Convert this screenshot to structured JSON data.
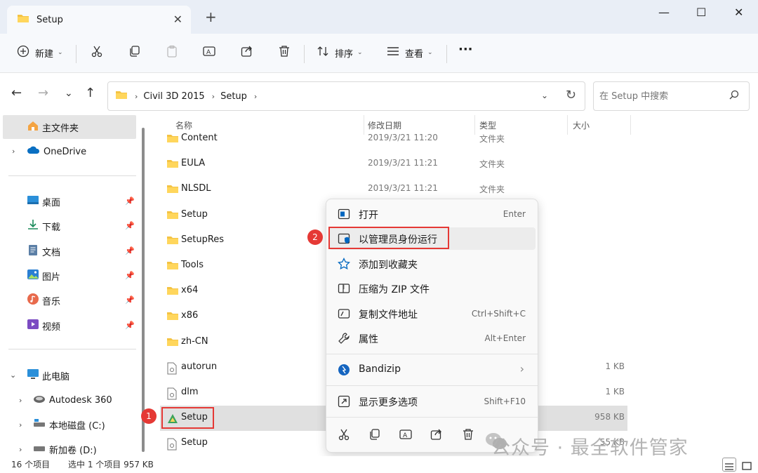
{
  "window": {
    "tab_title": "Setup",
    "close_tab": "✕",
    "new_tab": "+",
    "minimize": "—",
    "maximize": "☐",
    "close": "✕"
  },
  "toolbar": {
    "new_label": "新建",
    "sort_label": "排序",
    "view_label": "查看",
    "more_label": "···"
  },
  "address": {
    "crumbs": [
      "Civil 3D 2015",
      "Setup"
    ],
    "search_placeholder": "在 Setup 中搜索"
  },
  "sidebar": {
    "home": "主文件夹",
    "onedrive": "OneDrive",
    "quick": [
      "桌面",
      "下载",
      "文档",
      "图片",
      "音乐",
      "视频"
    ],
    "this_pc": "此电脑",
    "drives": [
      "Autodesk 360",
      "本地磁盘 (C:)",
      "新加卷 (D:)"
    ]
  },
  "columns": {
    "name": "名称",
    "modified": "修改日期",
    "type": "类型",
    "size": "大小"
  },
  "files": [
    {
      "name": "Content",
      "date": "2019/3/21 11:20",
      "type": "文件夹",
      "size": "",
      "kind": "folder"
    },
    {
      "name": "EULA",
      "date": "2019/3/21 11:21",
      "type": "文件夹",
      "size": "",
      "kind": "folder"
    },
    {
      "name": "NLSDL",
      "date": "2019/3/21 11:21",
      "type": "文件夹",
      "size": "",
      "kind": "folder"
    },
    {
      "name": "Setup",
      "date": "",
      "type": "",
      "size": "",
      "kind": "folder"
    },
    {
      "name": "SetupRes",
      "date": "",
      "type": "",
      "size": "",
      "kind": "folder"
    },
    {
      "name": "Tools",
      "date": "",
      "type": "",
      "size": "",
      "kind": "folder"
    },
    {
      "name": "x64",
      "date": "",
      "type": "",
      "size": "",
      "kind": "folder"
    },
    {
      "name": "x86",
      "date": "",
      "type": "",
      "size": "",
      "kind": "folder"
    },
    {
      "name": "zh-CN",
      "date": "",
      "type": "",
      "size": "",
      "kind": "folder"
    },
    {
      "name": "autorun",
      "date": "",
      "type": "",
      "size": "1 KB",
      "kind": "file"
    },
    {
      "name": "dlm",
      "date": "",
      "type": "",
      "size": "1 KB",
      "kind": "file"
    },
    {
      "name": "Setup",
      "date": "",
      "type": "",
      "size": "958 KB",
      "kind": "exe"
    },
    {
      "name": "Setup",
      "date": "",
      "type": "",
      "size": "55 KB",
      "kind": "file"
    }
  ],
  "context_menu": {
    "items": [
      {
        "label": "打开",
        "key": "Enter"
      },
      {
        "label": "以管理员身份运行",
        "key": ""
      },
      {
        "label": "添加到收藏夹",
        "key": ""
      },
      {
        "label": "压缩为 ZIP 文件",
        "key": ""
      },
      {
        "label": "复制文件地址",
        "key": "Ctrl+Shift+C"
      },
      {
        "label": "属性",
        "key": "Alt+Enter"
      },
      {
        "label": "Bandizip",
        "key": "›"
      },
      {
        "label": "显示更多选项",
        "key": "Shift+F10"
      }
    ]
  },
  "annotations": {
    "badge1": "1",
    "badge2": "2"
  },
  "status": {
    "count": "16 个项目",
    "selected": "选中 1 个项目  957 KB"
  },
  "watermark": "公众号 · 最全软件管家",
  "colors": {
    "folder": "#f4c343",
    "accent": "#0067c0",
    "red": "#e53935"
  }
}
